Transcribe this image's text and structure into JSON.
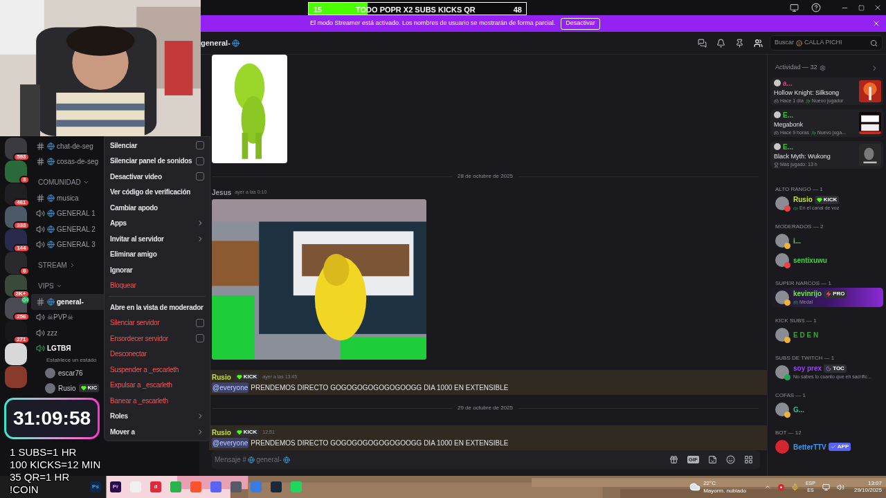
{
  "title_bar": {
    "goal": {
      "current": "15",
      "label": "TODO POPR X2 SUBS KICKS QR",
      "target": "48",
      "level": 0.27
    }
  },
  "banner": {
    "text": "El modo Streamer está activado. Los nombres de usuario se mostrarán de forma parcial.",
    "button": "Desactivar"
  },
  "servers": [
    {
      "badge": "593",
      "voice": false
    },
    {
      "badge": "3",
      "voice": false
    },
    {
      "badge": "461",
      "voice": false
    },
    {
      "badge": "333",
      "voice": false
    },
    {
      "badge": "144",
      "voice": false
    },
    {
      "badge": "8",
      "voice": false
    },
    {
      "badge": "2K+",
      "voice": false
    },
    {
      "badge": "256",
      "voice": true
    },
    {
      "badge": "271",
      "voice": false
    },
    {
      "voice": false
    },
    {
      "voice": false
    }
  ],
  "channels": [
    {
      "kind": "text",
      "name": "chat-de-seg",
      "emoji": true,
      "selected": false
    },
    {
      "kind": "text",
      "name": "cosas-de-seg",
      "emoji": true,
      "selected": false
    },
    {
      "kind": "category",
      "name": "COMUNIDAD",
      "expanded": true
    },
    {
      "kind": "text",
      "name": "musica",
      "emoji": true,
      "selected": false
    },
    {
      "kind": "voice",
      "name": "GENERAL 1",
      "emoji": true,
      "selected": false,
      "connected": false
    },
    {
      "kind": "voice",
      "name": "GENERAL 2",
      "emoji": true,
      "selected": false,
      "connected": false
    },
    {
      "kind": "voice",
      "name": "GENERAL 3",
      "emoji": true,
      "selected": false,
      "connected": false
    },
    {
      "kind": "category",
      "name": "STREAM",
      "expanded": false
    },
    {
      "kind": "category",
      "name": "VIPS",
      "expanded": true
    },
    {
      "kind": "text",
      "name": "general-",
      "emoji": true,
      "selected": true
    },
    {
      "kind": "voice",
      "name": "☠PVP☠",
      "emoji": false,
      "selected": false,
      "connected": false
    },
    {
      "kind": "voice",
      "name": "zzz",
      "emoji": false,
      "selected": false,
      "connected": false
    },
    {
      "kind": "voice",
      "name": "LGTBЯ",
      "emoji": false,
      "selected": false,
      "connected": true,
      "status": "Establece un estado",
      "children": [
        {
          "name": "escar76"
        },
        {
          "name": "Rusio",
          "badge": "KIC"
        }
      ]
    }
  ],
  "context_menu": [
    {
      "kind": "check",
      "label": "Silenciar",
      "danger": false,
      "checked": false
    },
    {
      "kind": "check",
      "label": "Silenciar panel de sonidos",
      "danger": false,
      "checked": false
    },
    {
      "kind": "check",
      "label": "Desactivar video",
      "danger": false,
      "checked": false
    },
    {
      "kind": "item",
      "label": "Ver código de verificación",
      "danger": false
    },
    {
      "kind": "item",
      "label": "Cambiar apodo",
      "danger": false
    },
    {
      "kind": "submenu",
      "label": "Apps",
      "danger": false
    },
    {
      "kind": "submenu",
      "label": "Invitar al servidor",
      "danger": false
    },
    {
      "kind": "item",
      "label": "Eliminar amigo",
      "danger": false
    },
    {
      "kind": "item",
      "label": "Ignorar",
      "danger": false
    },
    {
      "kind": "item",
      "label": "Bloquear",
      "danger": true
    },
    {
      "kind": "divider"
    },
    {
      "kind": "item",
      "label": "Abre en la vista de moderador",
      "danger": false
    },
    {
      "kind": "check",
      "label": "Silenciar servidor",
      "danger": true,
      "checked": false
    },
    {
      "kind": "check",
      "label": "Ensordecer servidor",
      "danger": true,
      "checked": false
    },
    {
      "kind": "item",
      "label": "Desconectar",
      "danger": true
    },
    {
      "kind": "item",
      "label": "Suspender a _escarleth",
      "danger": true
    },
    {
      "kind": "item",
      "label": "Expulsar a _escarleth",
      "danger": true
    },
    {
      "kind": "item",
      "label": "Banear a _escarleth",
      "danger": true
    },
    {
      "kind": "submenu",
      "label": "Roles",
      "danger": false
    },
    {
      "kind": "submenu",
      "label": "Mover a",
      "danger": false
    }
  ],
  "chat": {
    "channel": "general-",
    "search": {
      "prefix": "Buscar",
      "name": "CALLA PICHI"
    },
    "messages": [
      {
        "kind": "attachment"
      },
      {
        "kind": "divider",
        "text": "28 de octubre de 2025"
      },
      {
        "kind": "message",
        "author": "Jesus",
        "color": "#9a9aa2",
        "time": "ayer a las 0:10",
        "attachment": true
      },
      {
        "kind": "message",
        "author": "Rusio",
        "color": "#c6e13a",
        "badge": "KICK",
        "time": "ayer a las 13:45",
        "mention": "@everyone",
        "text": "PRENDEMOS DIRECTO GOGOGOGOGOGOGOOGG DIA 1000 EN EXTENSIBLE",
        "highlighted": true,
        "attachment": false
      },
      {
        "kind": "divider",
        "text": "29 de octubre de 2025"
      },
      {
        "kind": "message",
        "author": "Rusio",
        "color": "#c6e13a",
        "badge": "KICK",
        "time": "12:51",
        "mention": "@everyone",
        "text": "PRENDEMOS DIRECTO GOGOGOGOGOGOGOOGG DIA 1000 EN EXTENSIBLE",
        "highlighted": true,
        "attachment": false
      }
    ],
    "composer": {
      "prefix": "Mensaje #",
      "channel": "general-",
      "gif": "GIF"
    }
  },
  "members": {
    "activity_title": "Actividad — 32",
    "activities": [
      {
        "user": "a...",
        "color": "#d0427f",
        "game": "Hollow Knight: Silksong",
        "stats": [
          {
            "kind": "time",
            "text": "Hace 1 día"
          },
          {
            "kind": "new",
            "text": "Nuevo jugador"
          }
        ]
      },
      {
        "user": "E...",
        "color": "#3ec23e",
        "game": "Megabonk",
        "stats": [
          {
            "kind": "time",
            "text": "Hace 9 horas"
          },
          {
            "kind": "new",
            "text": "Nuevo juga..."
          }
        ]
      },
      {
        "user": "E...",
        "color": "#3ec23e",
        "game": "Black Myth: Wukong",
        "stats": [
          {
            "kind": "trophy",
            "text": "Más jugado: 13 h"
          }
        ]
      }
    ],
    "groups": [
      {
        "title": "ALTO RANGO — 1",
        "members": [
          {
            "name": "Rusio",
            "color": "#c6e13a",
            "status": {
              "color": "#f23f43"
            },
            "badge": {
              "kind": "kick",
              "text": "KICK"
            },
            "sub": {
              "kind": "voice",
              "text": "En el canal de voz"
            },
            "highlighted": false
          }
        ]
      },
      {
        "title": "MODERADOS — 2",
        "members": [
          {
            "name": "i...",
            "color": "#7fd13b",
            "status": {
              "color": "#f0b232"
            },
            "highlighted": false
          },
          {
            "name": "sentixuwu",
            "color": "#3ed63e",
            "status": {
              "color": "#f23f43"
            },
            "highlighted": false
          }
        ]
      },
      {
        "title": "SUPER NARCOS — 1",
        "members": [
          {
            "name": "kevinrijo",
            "color": "#6ee83b",
            "status": {
              "color": "#f0b232"
            },
            "badge": {
              "kind": "pro",
              "text": "PRO"
            },
            "sub": {
              "kind": "game",
              "text": "Medal"
            },
            "highlighted": true
          }
        ]
      },
      {
        "title": "KICK SUBS — 1",
        "members": [
          {
            "name": "E D E N",
            "color": "#3aa63a",
            "status": {
              "color": "#f0b232"
            },
            "highlighted": false
          }
        ]
      },
      {
        "title": "SUBS DE TWITCH — 1",
        "members": [
          {
            "name": "soy prex",
            "color": "#a040ff",
            "status": {
              "color": "#23a55a"
            },
            "badge": {
              "kind": "toc",
              "text": "TOC"
            },
            "sub": {
              "kind": "text",
              "text": "No sabes lo cuanto que eh sacrific..."
            },
            "highlighted": false
          }
        ]
      },
      {
        "title": "COFAS — 1",
        "members": [
          {
            "name": "G...",
            "color": "#2fbf8f",
            "status": {
              "color": "#f0b232"
            },
            "highlighted": false
          }
        ]
      },
      {
        "title": "BOT — 12",
        "members": [
          {
            "name": "BetterTTV",
            "color": "#3e9bf0",
            "badge": {
              "kind": "app",
              "text": "APP"
            },
            "highlighted": false
          }
        ]
      }
    ]
  },
  "overlay": {
    "timer": "31:09:58",
    "lines": [
      "1 SUBS=1 HR",
      "100 KICKS=12 MIN",
      "35 QR=1 HR",
      "!COIN"
    ]
  },
  "taskbar": {
    "apps": [
      {
        "kind": "ps",
        "label": "Ps"
      },
      {
        "kind": "pr",
        "label": "Pr"
      },
      {
        "kind": "store"
      },
      {
        "kind": "dict",
        "label": "d"
      },
      {
        "kind": "block"
      },
      {
        "kind": "brave"
      },
      {
        "kind": "discord"
      },
      {
        "kind": "circle"
      },
      {
        "kind": "chrome"
      },
      {
        "kind": "steam"
      },
      {
        "kind": "spotify"
      }
    ],
    "weather": {
      "temp": "22°C",
      "text": "Mayorm. nublado"
    },
    "lang": {
      "top": "ESP",
      "bottom": "ES"
    },
    "clock": {
      "time": "13:07",
      "date": "29/10/2025"
    }
  }
}
